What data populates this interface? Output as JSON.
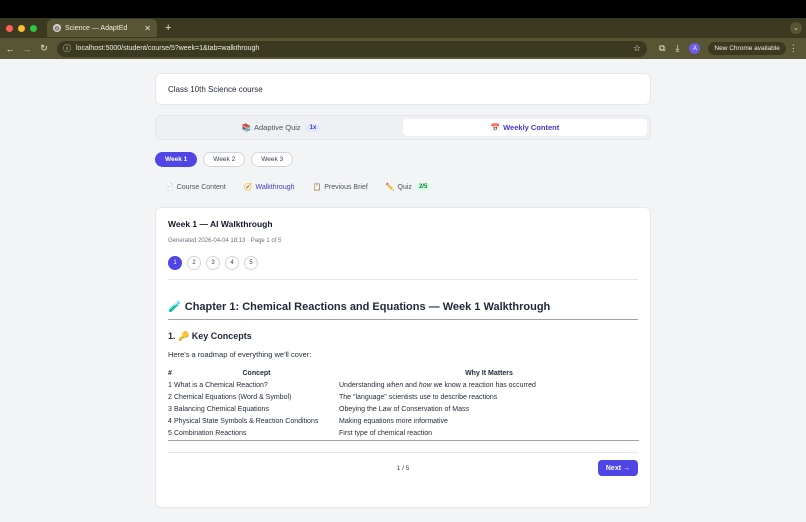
{
  "browser": {
    "tab_title": "Science — AdaptEd",
    "url": "localhost:5000/student/course/5?week=1&tab=walkthrough",
    "update_label": "New Chrome available",
    "profile_initial": "A"
  },
  "course": {
    "title": "Class 10th Science course"
  },
  "mode_tabs": {
    "adaptive_quiz": "Adaptive Quiz",
    "adaptive_badge": "1x",
    "weekly_content": "Weekly Content"
  },
  "weeks": [
    "Week 1",
    "Week 2",
    "Week 3"
  ],
  "sub_tabs": {
    "course_content": "Course Content",
    "walkthrough": "Walkthrough",
    "previous_brief": "Previous Brief",
    "quiz": "Quiz",
    "quiz_badge": "2/5"
  },
  "walkthrough": {
    "title": "Week 1 — AI Walkthrough",
    "meta": "Generated 2026-04-04 18:13 · Page 1 of 5",
    "pages": [
      "1",
      "2",
      "3",
      "4",
      "5"
    ],
    "chapter_title": "Chapter 1: Chemical Reactions and Equations — Week 1 Walkthrough",
    "section_title": "1. 🔑 Key Concepts",
    "intro": "Here's a roadmap of everything we'll cover:",
    "table": {
      "headers": [
        "#",
        "Concept",
        "Why It Matters"
      ],
      "rows": [
        {
          "num": "1",
          "concept": "What is a Chemical Reaction?",
          "why_pre": "Understanding ",
          "why_em1": "when",
          "why_mid": " and ",
          "why_em2": "how",
          "why_post": " we know a reaction has occurred"
        },
        {
          "num": "2",
          "concept": "Chemical Equations (Word & Symbol)",
          "why": "The \"language\" scientists use to describe reactions"
        },
        {
          "num": "3",
          "concept": "Balancing Chemical Equations",
          "why": "Obeying the Law of Conservation of Mass"
        },
        {
          "num": "4",
          "concept": "Physical State Symbols & Reaction Conditions",
          "why": "Making equations more informative"
        },
        {
          "num": "5",
          "concept": "Combination Reactions",
          "why": "First type of chemical reaction"
        }
      ]
    },
    "page_indicator": "1 / 5",
    "next_label": "Next →"
  }
}
